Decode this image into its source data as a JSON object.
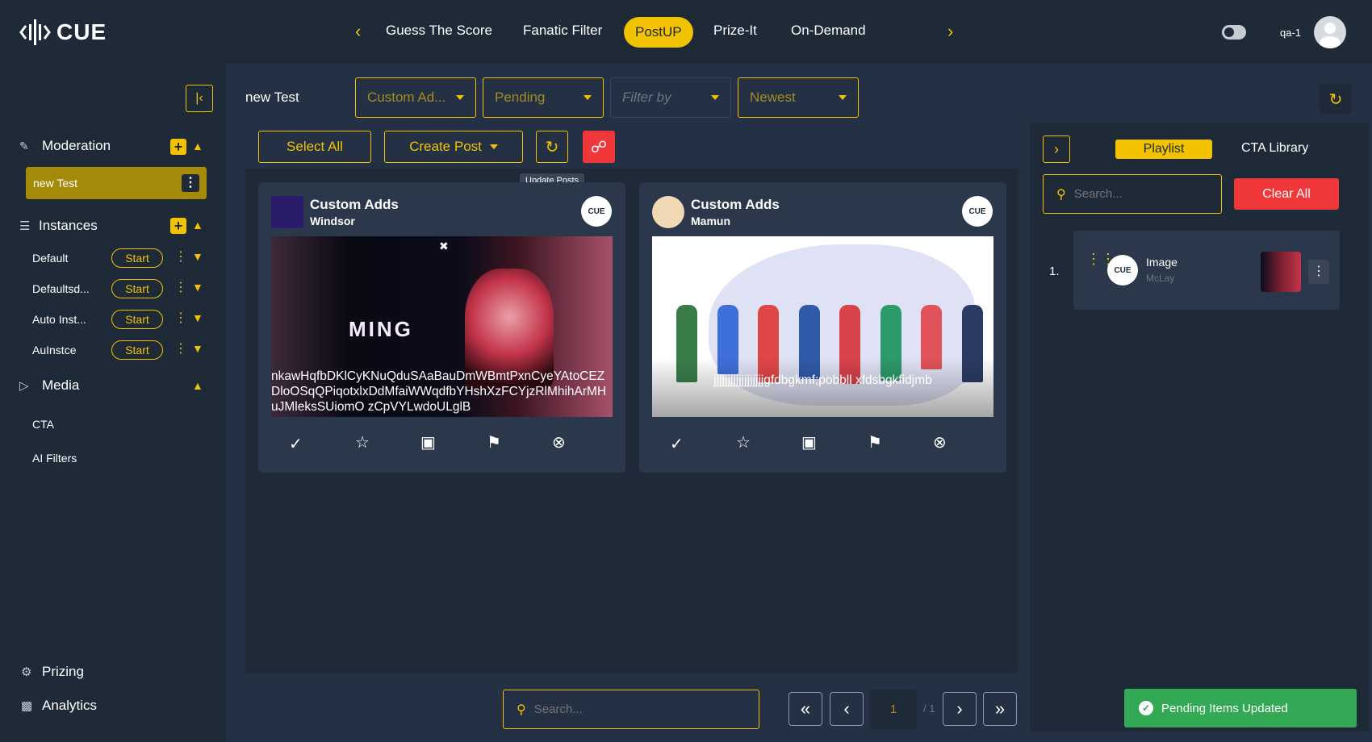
{
  "app": {
    "logo_text": "CUE"
  },
  "topnav": {
    "tabs": [
      "Guess The Score",
      "Fanatic Filter",
      "PostUP",
      "Prize-It",
      "On-Demand"
    ],
    "active_tab": "PostUP",
    "user": "qa-1"
  },
  "sidebar": {
    "moderation_label": "Moderation",
    "moderation_item": "new Test",
    "instances_label": "Instances",
    "instances": [
      {
        "name": "Default",
        "action": "Start"
      },
      {
        "name": "Defaultsd...",
        "action": "Start"
      },
      {
        "name": "Auto Inst...",
        "action": "Start"
      },
      {
        "name": "AuInstce",
        "action": "Start"
      }
    ],
    "media_label": "Media",
    "media_items": [
      "CTA",
      "AI Filters"
    ],
    "prizing_label": "Prizing",
    "analytics_label": "Analytics"
  },
  "toolbar": {
    "title": "new Test",
    "filters": [
      "Custom Ad...",
      "Pending",
      "Filter by",
      "Newest"
    ],
    "select_all": "Select All",
    "create_post": "Create Post",
    "tooltip": "Update Posts"
  },
  "cards": [
    {
      "title": "Custom Adds",
      "author": "Windsor",
      "caption": "nkawHqfbDKlCyKNuQduSAaBauDmWBmtPxnCyeYAtoCEZDloOSqQPiqotxlxDdMfaiWWqdfbYHshXzFCYjzRlMhihArMHuJMleksSUiomO zCpVYLwdoULglB",
      "overlay_text": "MING",
      "badge": "CUE"
    },
    {
      "title": "Custom Adds",
      "author": "Mamun",
      "caption": "jjjjjjjjjjjjjjjjjjgfdbgkmf;pobbll xfdsbgkfidjmb",
      "badge": "CUE"
    }
  ],
  "bottom": {
    "search_placeholder": "Search...",
    "page": "1",
    "page_total": "/ 1"
  },
  "right_panel": {
    "tab_playlist": "Playlist",
    "tab_cta": "CTA Library",
    "search_placeholder": "Search...",
    "clear_all": "Clear All",
    "items": [
      {
        "index": "1.",
        "title": "Image",
        "subtitle": "McLay",
        "badge": "CUE"
      }
    ]
  },
  "toast": {
    "message": "Pending Items Updated"
  },
  "colors": {
    "accent": "#f2c200",
    "danger": "#f0383a",
    "success": "#33a955",
    "bg": "#1f2a38"
  }
}
